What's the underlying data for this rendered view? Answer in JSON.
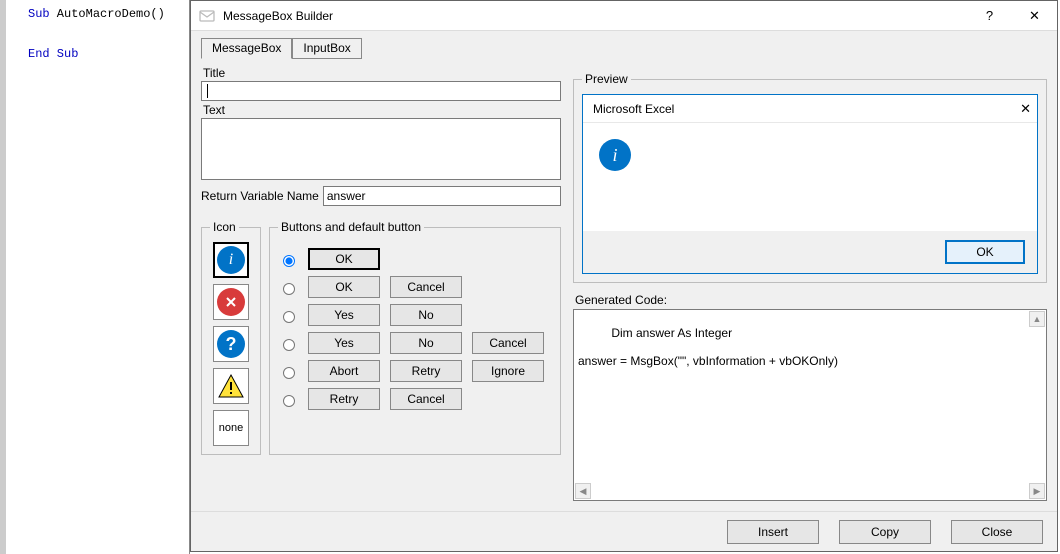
{
  "code": {
    "line1_kw1": "Sub",
    "line1_rest": " AutoMacroDemo()",
    "line2_kw": "End Sub"
  },
  "dialog": {
    "title": "MessageBox Builder",
    "help_label": "?",
    "close_label": "✕"
  },
  "tabs": {
    "messagebox": "MessageBox",
    "inputbox": "InputBox"
  },
  "fields": {
    "title_label": "Title",
    "title_value": "",
    "text_label": "Text",
    "text_value": "",
    "return_label": "Return Variable Name",
    "return_value": "answer"
  },
  "icon_group": {
    "legend": "Icon",
    "none_label": "none"
  },
  "buttons_group": {
    "legend": "Buttons and default button",
    "ok": "OK",
    "cancel": "Cancel",
    "yes": "Yes",
    "no": "No",
    "abort": "Abort",
    "retry": "Retry",
    "ignore": "Ignore"
  },
  "preview": {
    "legend": "Preview",
    "title": "Microsoft Excel",
    "close_label": "✕",
    "ok": "OK"
  },
  "generated": {
    "label": "Generated Code:",
    "code": "Dim answer As Integer\n\nanswer = MsgBox(\"\", vbInformation + vbOKOnly)"
  },
  "bottom": {
    "insert": "Insert",
    "copy": "Copy",
    "close": "Close"
  }
}
